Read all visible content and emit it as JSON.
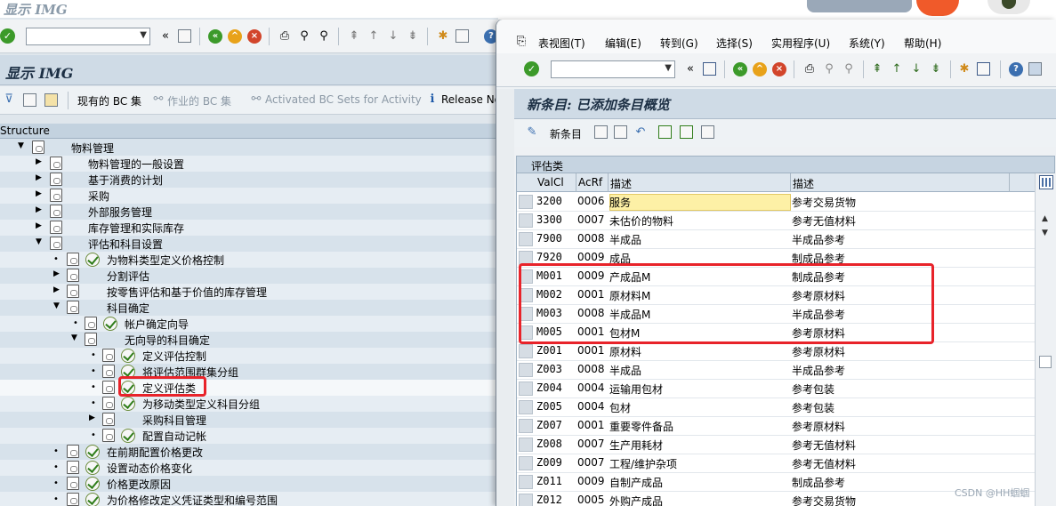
{
  "background_window": {
    "title": "显示 IMG",
    "header": "显示 IMG",
    "app_toolbar": {
      "bc_sets": "现有的 BC 集",
      "activity_bc_sets": "作业的 BC 集",
      "activated_bc_sets": "Activated BC Sets for Activity",
      "release_notes": "Release No"
    },
    "structure_header": "Structure",
    "tree": [
      {
        "label": "物料管理"
      },
      {
        "label": "物料管理的一般设置"
      },
      {
        "label": "基于消费的计划"
      },
      {
        "label": "采购"
      },
      {
        "label": "外部服务管理"
      },
      {
        "label": "库存管理和实际库存"
      },
      {
        "label": "评估和科目设置"
      },
      {
        "label": "为物料类型定义价格控制"
      },
      {
        "label": "分割评估"
      },
      {
        "label": "按零售评估和基于价值的库存管理"
      },
      {
        "label": "科目确定"
      },
      {
        "label": "帐户确定向导"
      },
      {
        "label": "无向导的科目确定"
      },
      {
        "label": "定义评估控制"
      },
      {
        "label": "将评估范围群集分组"
      },
      {
        "label": "定义评估类"
      },
      {
        "label": "为移动类型定义科目分组"
      },
      {
        "label": "采购科目管理"
      },
      {
        "label": "配置自动记帐"
      },
      {
        "label": "在前期配置价格更改"
      },
      {
        "label": "设置动态价格变化"
      },
      {
        "label": "价格更改原因"
      },
      {
        "label": "为价格修改定义凭证类型和编号范围"
      }
    ]
  },
  "dialog": {
    "menu": [
      "表视图(T)",
      "编辑(E)",
      "转到(G)",
      "选择(S)",
      "实用程序(U)",
      "系统(Y)",
      "帮助(H)"
    ],
    "title": "新条目: 已添加条目概览",
    "new_entries_label": "新条目",
    "table": {
      "caption": "评估类",
      "columns": [
        "ValCl",
        "AcRf",
        "描述",
        "描述"
      ],
      "rows": [
        {
          "valcl": "3200",
          "acrf": "0006",
          "desc": "服务",
          "ref": "参考交易货物"
        },
        {
          "valcl": "3300",
          "acrf": "0007",
          "desc": "未估价的物料",
          "ref": "参考无值材料"
        },
        {
          "valcl": "7900",
          "acrf": "0008",
          "desc": "半成品",
          "ref": "半成品参考"
        },
        {
          "valcl": "7920",
          "acrf": "0009",
          "desc": "成品",
          "ref": "制成品参考"
        },
        {
          "valcl": "M001",
          "acrf": "0009",
          "desc": "产成品M",
          "ref": "制成品参考"
        },
        {
          "valcl": "M002",
          "acrf": "0001",
          "desc": "原材料M",
          "ref": "参考原材料"
        },
        {
          "valcl": "M003",
          "acrf": "0008",
          "desc": "半成品M",
          "ref": "半成品参考"
        },
        {
          "valcl": "M005",
          "acrf": "0001",
          "desc": "包材M",
          "ref": "参考原材料"
        },
        {
          "valcl": "Z001",
          "acrf": "0001",
          "desc": "原材料",
          "ref": "参考原材料"
        },
        {
          "valcl": "Z003",
          "acrf": "0008",
          "desc": "半成品",
          "ref": "半成品参考"
        },
        {
          "valcl": "Z004",
          "acrf": "0004",
          "desc": "运输用包材",
          "ref": "参考包装"
        },
        {
          "valcl": "Z005",
          "acrf": "0004",
          "desc": "包材",
          "ref": "参考包装"
        },
        {
          "valcl": "Z007",
          "acrf": "0001",
          "desc": "重要零件备品",
          "ref": "参考原材料"
        },
        {
          "valcl": "Z008",
          "acrf": "0007",
          "desc": "生产用耗材",
          "ref": "参考无值材料"
        },
        {
          "valcl": "Z009",
          "acrf": "0007",
          "desc": "工程/维护杂项",
          "ref": "参考无值材料"
        },
        {
          "valcl": "Z011",
          "acrf": "0009",
          "desc": "自制产成品",
          "ref": "制成品参考"
        },
        {
          "valcl": "Z012",
          "acrf": "0005",
          "desc": "外购产成品",
          "ref": "参考交易货物"
        }
      ]
    }
  },
  "watermark": "CSDN @HH蝈蝈",
  "colors": {
    "highlight_red": "#e8232a",
    "input_yellow": "#fdf0a6",
    "header_blue": "#cfdbe6"
  }
}
